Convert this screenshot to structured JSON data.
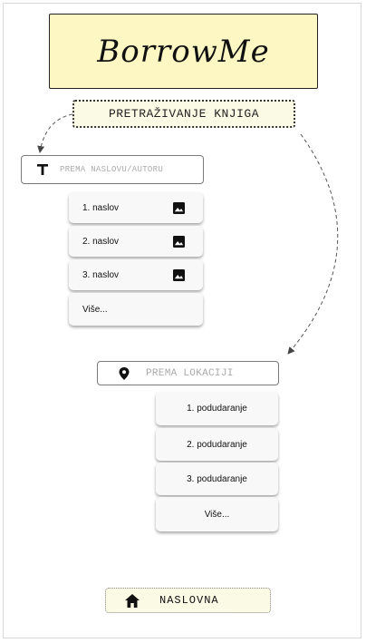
{
  "app": {
    "logo_text": "BorrowMe"
  },
  "search": {
    "header_label": "PRETRAŽIVANJE KNJIGA",
    "title_placeholder": "PREMA NASLOVU/AUTORU",
    "location_placeholder": "PREMA LOKACIJI"
  },
  "title_results": [
    {
      "label": "1. naslov",
      "icon": "image-icon"
    },
    {
      "label": "2. naslov",
      "icon": "image-icon"
    },
    {
      "label": "3. naslov",
      "icon": "image-icon"
    }
  ],
  "title_more_label": "Više...",
  "location_results": [
    {
      "label": "1. podudaranje"
    },
    {
      "label": "2. podudaranje"
    },
    {
      "label": "3. podudaranje"
    }
  ],
  "location_more_label": "Više...",
  "nav": {
    "home_label": "NASLOVNA",
    "home_icon": "home-icon"
  },
  "colors": {
    "logo_bg": "#fdf8c3",
    "header_bg": "#fbfae4",
    "card_bg": "#f8f8f8"
  }
}
